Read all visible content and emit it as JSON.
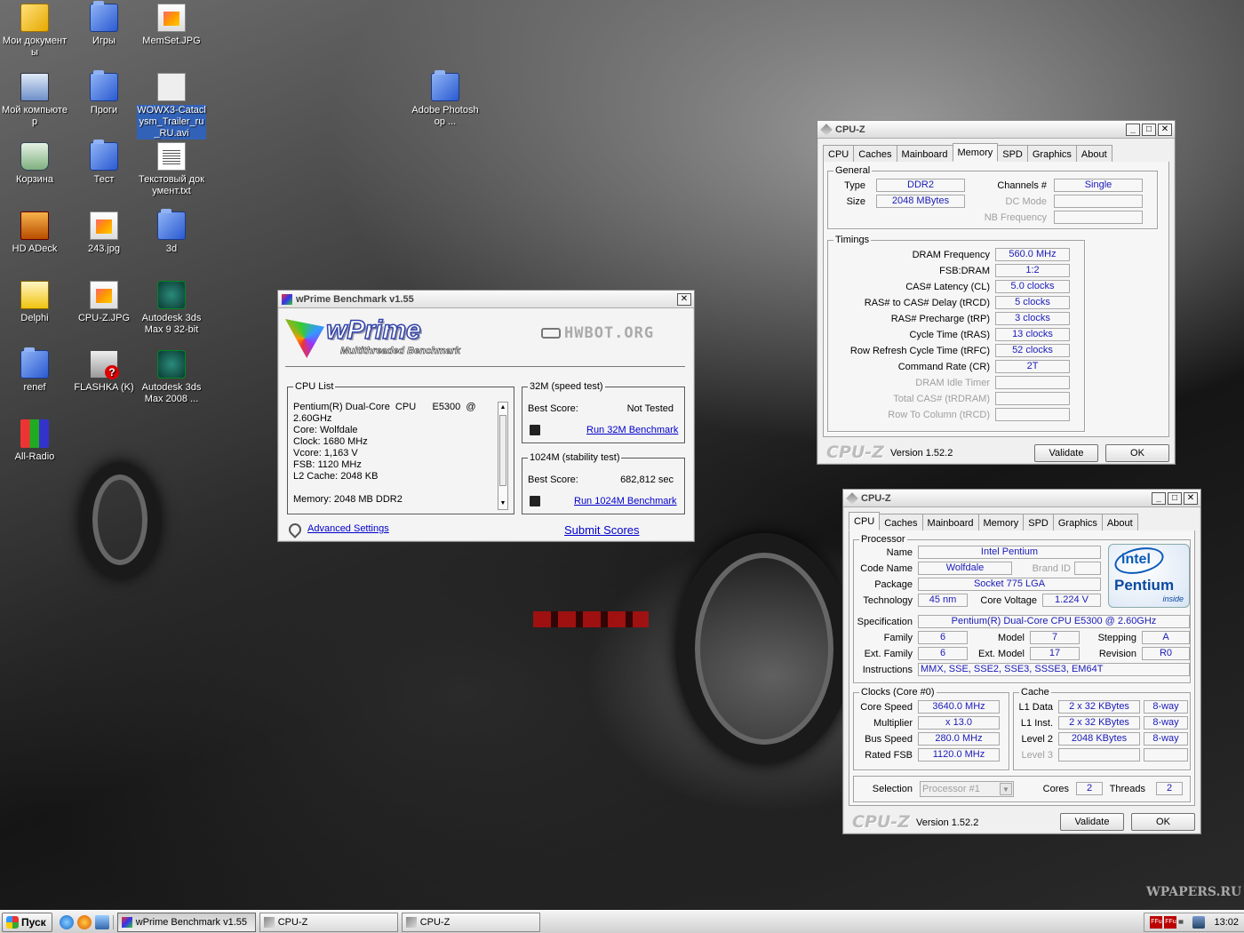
{
  "desktop": {
    "icons": [
      {
        "label": "Мои документы",
        "icon": "my-documents-icon"
      },
      {
        "label": "Игры",
        "icon": "folder-icon"
      },
      {
        "label": "MemSet.JPG",
        "icon": "jpg-file-icon"
      },
      {
        "label": "Мой компьютер",
        "icon": "my-computer-icon"
      },
      {
        "label": "Проги",
        "icon": "folder-icon"
      },
      {
        "label": "WOWX3-Cataclysm_Trailer_ru_RU.avi",
        "icon": "avi-file-icon"
      },
      {
        "label": "Adobe Photoshop ...",
        "icon": "folder-icon"
      },
      {
        "label": "Корзина",
        "icon": "recycle-bin-icon"
      },
      {
        "label": "Тест",
        "icon": "folder-icon"
      },
      {
        "label": "Текстовый документ.txt",
        "icon": "text-file-icon"
      },
      {
        "label": "HD ADeck",
        "icon": "via-vinyl-icon"
      },
      {
        "label": "243.jpg",
        "icon": "jpg-file-icon"
      },
      {
        "label": "3d",
        "icon": "folder-icon"
      },
      {
        "label": "Delphi",
        "icon": "delphi-icon"
      },
      {
        "label": "CPU-Z.JPG",
        "icon": "jpg-file-icon"
      },
      {
        "label": "Autodesk 3ds Max 9 32-bit",
        "icon": "autodesk-icon"
      },
      {
        "label": "renef",
        "icon": "folder-icon"
      },
      {
        "label": "FLASHKA (K)",
        "icon": "drive-icon"
      },
      {
        "label": "Autodesk 3ds Max 2008 ...",
        "icon": "autodesk-icon"
      },
      {
        "label": "All-Radio",
        "icon": "all-radio-icon"
      }
    ],
    "watermark": "WPAPERS.RU"
  },
  "wprime": {
    "title": "wPrime Benchmark v1.55",
    "logo": "wPrime",
    "logo_sub": "Multithreaded Benchmark",
    "hwbot": "HWBOT.ORG",
    "cpu_list_legend": "CPU List",
    "cpu_list": [
      "Pentium(R) Dual-Core  CPU      E5300  @",
      "2.60GHz",
      "Core: Wolfdale",
      "Clock: 1680 MHz",
      "Vcore: 1,163 V",
      "FSB: 1120 MHz",
      "L2 Cache: 2048 KB",
      "",
      "Memory: 2048 MB DDR2"
    ],
    "test32_legend": "32M (speed test)",
    "test32_best_label": "Best Score:",
    "test32_best_value": "Not Tested",
    "test32_run": "Run 32M Benchmark",
    "test1024_legend": "1024M (stability test)",
    "test1024_best_label": "Best Score:",
    "test1024_best_value": "682,812 sec",
    "test1024_run": "Run 1024M Benchmark",
    "advanced": "Advanced Settings",
    "submit": "Submit Scores"
  },
  "cpuz_mem": {
    "title": "CPU-Z",
    "tabs": [
      "CPU",
      "Caches",
      "Mainboard",
      "Memory",
      "SPD",
      "Graphics",
      "About"
    ],
    "active_tab": "Memory",
    "general_legend": "General",
    "type_label": "Type",
    "type_value": "DDR2",
    "size_label": "Size",
    "size_value": "2048 MBytes",
    "channels_label": "Channels #",
    "channels_value": "Single",
    "dcmode_label": "DC Mode",
    "nbfreq_label": "NB Frequency",
    "timings_legend": "Timings",
    "timings": [
      {
        "label": "DRAM Frequency",
        "value": "560.0 MHz",
        "enabled": true
      },
      {
        "label": "FSB:DRAM",
        "value": "1:2",
        "enabled": true
      },
      {
        "label": "CAS# Latency (CL)",
        "value": "5.0 clocks",
        "enabled": true
      },
      {
        "label": "RAS# to CAS# Delay (tRCD)",
        "value": "5 clocks",
        "enabled": true
      },
      {
        "label": "RAS# Precharge (tRP)",
        "value": "3 clocks",
        "enabled": true
      },
      {
        "label": "Cycle Time (tRAS)",
        "value": "13 clocks",
        "enabled": true
      },
      {
        "label": "Row Refresh Cycle Time (tRFC)",
        "value": "52 clocks",
        "enabled": true
      },
      {
        "label": "Command Rate (CR)",
        "value": "2T",
        "enabled": true
      },
      {
        "label": "DRAM Idle Timer",
        "value": "",
        "enabled": false
      },
      {
        "label": "Total CAS# (tRDRAM)",
        "value": "",
        "enabled": false
      },
      {
        "label": "Row To Column (tRCD)",
        "value": "",
        "enabled": false
      }
    ],
    "logo": "CPU-Z",
    "version": "Version 1.52.2",
    "validate": "Validate",
    "ok": "OK"
  },
  "cpuz_cpu": {
    "title": "CPU-Z",
    "tabs": [
      "CPU",
      "Caches",
      "Mainboard",
      "Memory",
      "SPD",
      "Graphics",
      "About"
    ],
    "active_tab": "CPU",
    "processor_legend": "Processor",
    "name_label": "Name",
    "name_value": "Intel Pentium",
    "codename_label": "Code Name",
    "codename_value": "Wolfdale",
    "brandid_label": "Brand ID",
    "package_label": "Package",
    "package_value": "Socket 775 LGA",
    "tech_label": "Technology",
    "tech_value": "45 nm",
    "voltage_label": "Core Voltage",
    "voltage_value": "1.224 V",
    "spec_label": "Specification",
    "spec_value": "Pentium(R) Dual-Core  CPU      E5300  @ 2.60GHz",
    "family_label": "Family",
    "family_value": "6",
    "model_label": "Model",
    "model_value": "7",
    "stepping_label": "Stepping",
    "stepping_value": "A",
    "extfamily_label": "Ext. Family",
    "extfamily_value": "6",
    "extmodel_label": "Ext. Model",
    "extmodel_value": "17",
    "revision_label": "Revision",
    "revision_value": "R0",
    "instr_label": "Instructions",
    "instr_value": "MMX, SSE, SSE2, SSE3, SSSE3, EM64T",
    "intel_logo": "intel",
    "intel_brand": "Pentium",
    "intel_inside": "inside",
    "clocks_legend": "Clocks (Core #0)",
    "corespeed_label": "Core Speed",
    "corespeed_value": "3640.0 MHz",
    "multiplier_label": "Multiplier",
    "multiplier_value": "x 13.0",
    "busspeed_label": "Bus Speed",
    "busspeed_value": "280.0 MHz",
    "ratedfsb_label": "Rated FSB",
    "ratedfsb_value": "1120.0 MHz",
    "cache_legend": "Cache",
    "l1d_label": "L1 Data",
    "l1d_value": "2 x 32 KBytes",
    "l1d_way": "8-way",
    "l1i_label": "L1 Inst.",
    "l1i_value": "2 x 32 KBytes",
    "l1i_way": "8-way",
    "l2_label": "Level 2",
    "l2_value": "2048 KBytes",
    "l2_way": "8-way",
    "l3_label": "Level 3",
    "selection_label": "Selection",
    "selection_value": "Processor #1",
    "cores_label": "Cores",
    "cores_value": "2",
    "threads_label": "Threads",
    "threads_value": "2",
    "logo": "CPU-Z",
    "version": "Version 1.52.2",
    "validate": "Validate",
    "ok": "OK"
  },
  "taskbar": {
    "start": "Пуск",
    "tasks": [
      "wPrime Benchmark v1.55",
      "CPU-Z",
      "CPU-Z"
    ],
    "tray_icons": [
      "FFu",
      "FFu"
    ],
    "clock": "13:02"
  }
}
